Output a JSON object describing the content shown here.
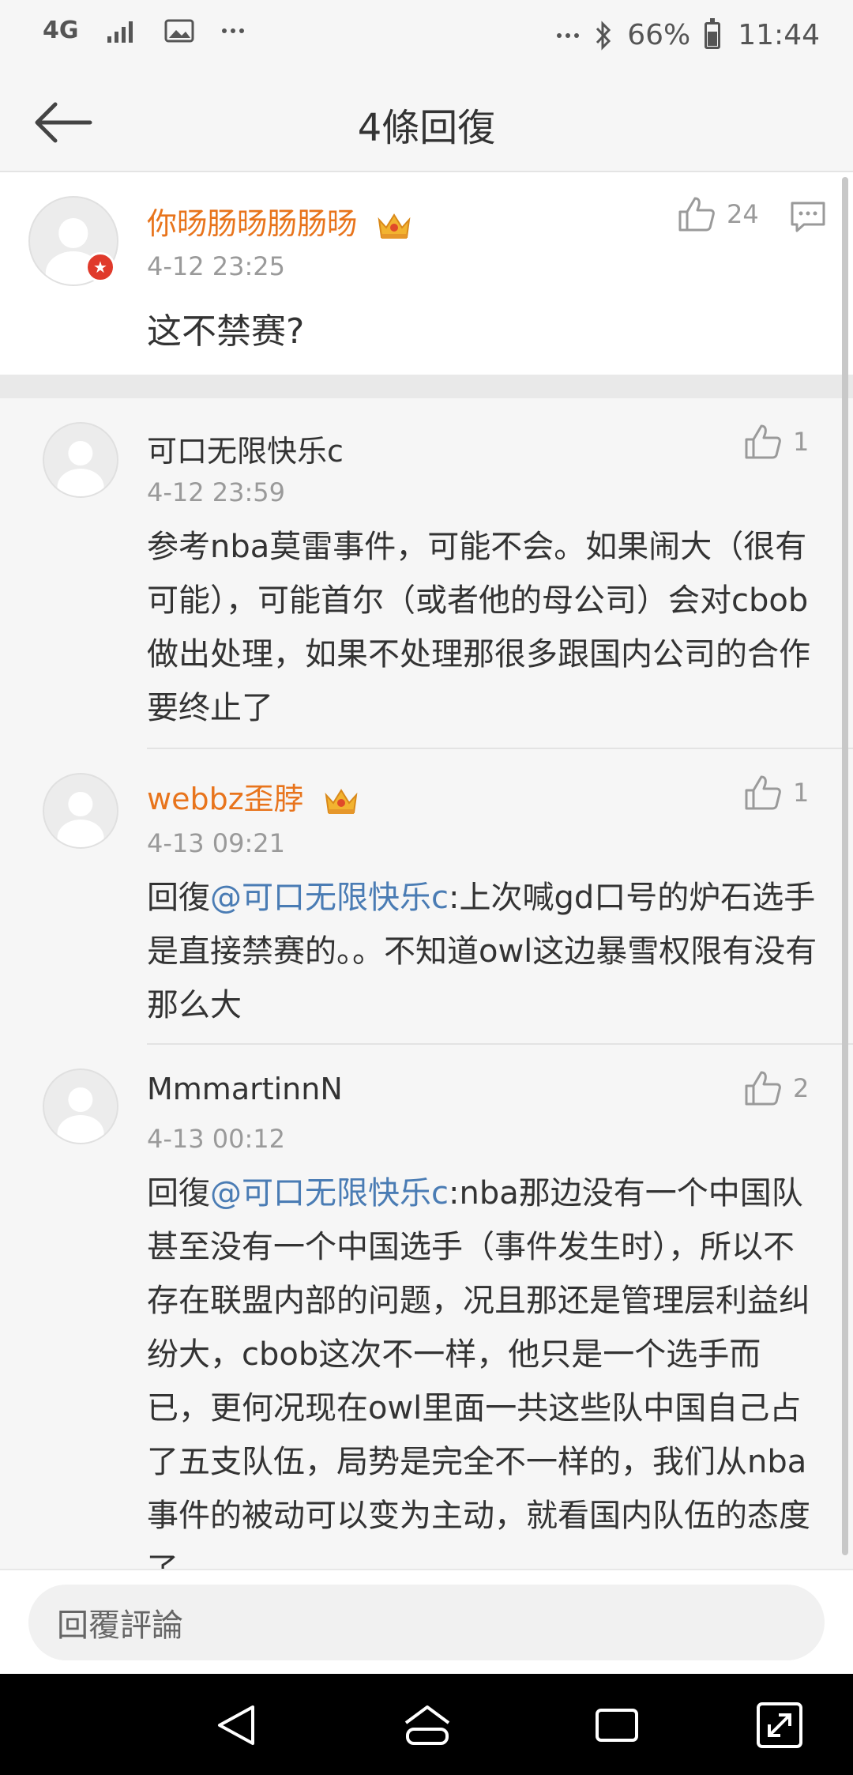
{
  "status_bar": {
    "network": "4G",
    "battery": "66%",
    "time": "11:44",
    "icons": [
      "signal-icon",
      "image-icon",
      "more-icon",
      "bluetooth-icon",
      "battery-icon"
    ]
  },
  "header": {
    "title": "4條回復",
    "back_icon": "back-arrow-icon"
  },
  "main_comment": {
    "username": "你旸肠旸肠肠旸",
    "time": "4-12 23:25",
    "likes": "24",
    "text": "这不禁赛?"
  },
  "replies": [
    {
      "username": "可口无限快乐c",
      "time": "4-12 23:59",
      "likes": "1",
      "text": "参考nba莫雷事件，可能不会。如果闹大（很有可能），可能首尔（或者他的母公司）会对cbob做出处理，如果不处理那很多跟国内公司的合作要终止了"
    },
    {
      "username": "webbz歪脖",
      "time": "4-13 09:21",
      "likes": "1",
      "prefix": "回復",
      "mention": "@可口无限快乐c",
      "text": ":上次喊gd口号的炉石选手是直接禁赛的。。不知道owl这边暴雪权限有没有那么大"
    },
    {
      "username": "MmmartinnN",
      "time": "4-13 00:12",
      "likes": "2",
      "prefix": "回復",
      "mention": "@可口无限快乐c",
      "text": ":nba那边没有一个中国队甚至没有一个中国选手（事件发生时），所以不存在联盟内部的问题，况且那还是管理层利益纠纷大，cbob这次不一样，他只是一个选手而已，更何况现在owl里面一共这些队中国自己占了五支队伍，局势是完全不一样的，我们从nba事件的被动可以变为主动，就看国内队伍的态度了"
    }
  ],
  "reply_input": {
    "placeholder": "回覆評論"
  },
  "colors": {
    "username_vip": "#e8741c",
    "mention": "#4a7cb4",
    "meta": "#9a9a9a"
  }
}
